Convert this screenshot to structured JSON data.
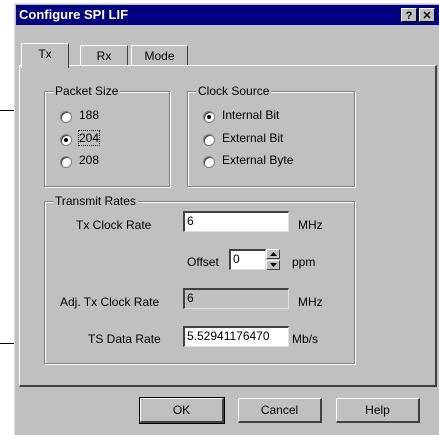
{
  "window": {
    "title": "Configure SPI LIF",
    "help_glyph": "?",
    "close_glyph": "✕"
  },
  "tabs": [
    {
      "label": "Tx",
      "active": true
    },
    {
      "label": "Rx",
      "active": false
    },
    {
      "label": "Mode",
      "active": false
    }
  ],
  "packet_size": {
    "label": "Packet Size",
    "options": [
      "188",
      "204",
      "208"
    ],
    "selected": "204"
  },
  "clock_source": {
    "label": "Clock Source",
    "options": [
      "Internal Bit",
      "External Bit",
      "External Byte"
    ],
    "selected": "Internal Bit"
  },
  "transmit_rates": {
    "label": "Transmit Rates",
    "tx_clock_rate": {
      "label": "Tx Clock Rate",
      "value": "6",
      "unit": "MHz"
    },
    "offset": {
      "label": "Offset",
      "value": "0",
      "unit": "ppm"
    },
    "adj_tx_clock_rate": {
      "label": "Adj. Tx Clock Rate",
      "value": "6",
      "unit": "MHz"
    },
    "ts_data_rate": {
      "label": "TS Data Rate",
      "value": "5.52941176470",
      "unit": "Mb/s"
    }
  },
  "buttons": {
    "ok": "OK",
    "cancel": "Cancel",
    "help": "Help"
  }
}
